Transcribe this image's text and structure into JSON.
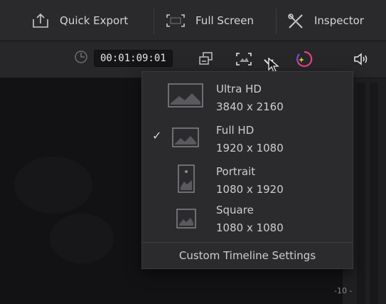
{
  "toolbar": {
    "quick_export_label": "Quick Export",
    "full_screen_label": "Full Screen",
    "inspector_label": "Inspector"
  },
  "subbar": {
    "timecode": "00:01:09:01"
  },
  "dropdown": {
    "items": [
      {
        "name": "Ultra HD",
        "dims": "3840 x 2160",
        "icon": "landscape-image-icon",
        "selected": false
      },
      {
        "name": "Full HD",
        "dims": "1920 x 1080",
        "icon": "landscape-image-icon",
        "selected": true
      },
      {
        "name": "Portrait",
        "dims": "1080 x 1920",
        "icon": "portrait-image-icon",
        "selected": false
      },
      {
        "name": "Square",
        "dims": "1080 x 1080",
        "icon": "square-image-icon",
        "selected": false
      }
    ],
    "check_mark": "✓",
    "custom_label": "Custom Timeline Settings"
  },
  "meter": {
    "label": "-10 -"
  },
  "colors": {
    "toolbar_bg": "#2a2a2d",
    "dropdown_bg": "#2b2b2e",
    "viewer_bg": "#121214",
    "text": "#cdcdcf",
    "accent_magenta": "#e0408a",
    "accent_yellow": "#e8c640"
  }
}
